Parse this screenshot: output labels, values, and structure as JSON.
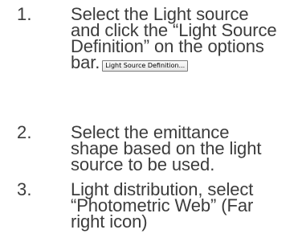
{
  "steps": [
    {
      "number": "1.",
      "lines": [
        "Select the Light source",
        "and click the “Light Source",
        "Definition” on the options",
        "bar."
      ],
      "inline_button": "Light Source Definition..."
    },
    {
      "number": "2.",
      "lines": [
        "Select the emittance",
        "shape based on the light",
        "source to be used."
      ]
    },
    {
      "number": "3.",
      "lines": [
        "Light distribution, select",
        "“Photometric Web” (Far",
        "right icon)"
      ]
    }
  ]
}
